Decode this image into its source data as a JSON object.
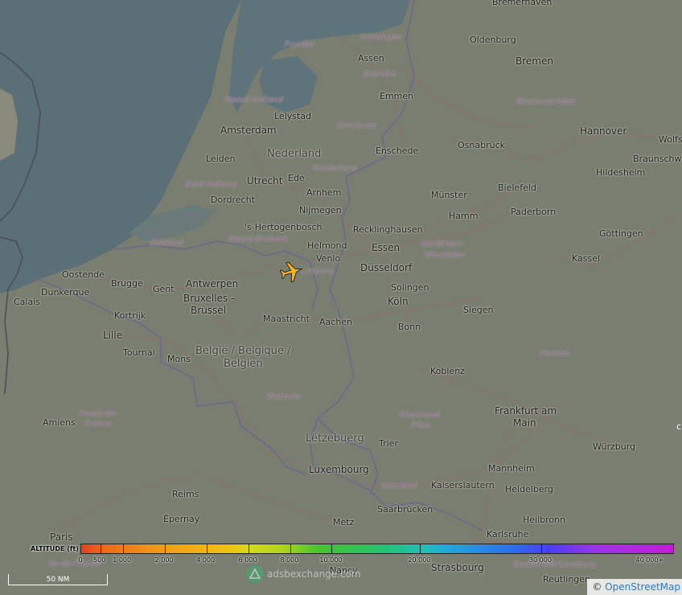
{
  "map": {
    "labels": [
      {
        "id": "bremerhaven",
        "text": "Bremerhaven",
        "cls": "city"
      },
      {
        "id": "oldenburg",
        "text": "Oldenburg",
        "cls": "city"
      },
      {
        "id": "bremen",
        "text": "Bremen",
        "cls": "big"
      },
      {
        "id": "niedersachsen",
        "text": "Niedersachsen",
        "cls": "region"
      },
      {
        "id": "hannover",
        "text": "Hannover",
        "cls": "big"
      },
      {
        "id": "wolfsburg",
        "text": "Wolfsb",
        "cls": "city"
      },
      {
        "id": "braunschweig",
        "text": "Braunschwei",
        "cls": "city"
      },
      {
        "id": "hildesheim",
        "text": "Hildesheim",
        "cls": "city"
      },
      {
        "id": "groningen",
        "text": "Groningen",
        "cls": "region"
      },
      {
        "id": "fryslan",
        "text": "Fryslân",
        "cls": "region"
      },
      {
        "id": "assen",
        "text": "Assen",
        "cls": "city"
      },
      {
        "id": "drenthe",
        "text": "Drenthe",
        "cls": "region"
      },
      {
        "id": "emmen",
        "text": "Emmen",
        "cls": "city"
      },
      {
        "id": "noord-holland",
        "text": "Noord-Holland",
        "cls": "region"
      },
      {
        "id": "lelystad",
        "text": "Lelystad",
        "cls": "city"
      },
      {
        "id": "overijssel",
        "text": "Overijssel",
        "cls": "region"
      },
      {
        "id": "amsterdam",
        "text": "Amsterdam",
        "cls": "big"
      },
      {
        "id": "nederland",
        "text": "Nederland",
        "cls": "country"
      },
      {
        "id": "enschede",
        "text": "Enschede",
        "cls": "city"
      },
      {
        "id": "osnabruck",
        "text": "Osnabrück",
        "cls": "city"
      },
      {
        "id": "leiden",
        "text": "Leiden",
        "cls": "city"
      },
      {
        "id": "gelderland",
        "text": "Gelderland",
        "cls": "region"
      },
      {
        "id": "utrecht",
        "text": "Utrecht",
        "cls": "big"
      },
      {
        "id": "ede",
        "text": "Ede",
        "cls": "city"
      },
      {
        "id": "zuid-holland",
        "text": "Zuid-Holland",
        "cls": "region"
      },
      {
        "id": "arnhem",
        "text": "Arnhem",
        "cls": "city"
      },
      {
        "id": "bielefeld",
        "text": "Bielefeld",
        "cls": "city"
      },
      {
        "id": "dordrecht",
        "text": "Dordrecht",
        "cls": "city"
      },
      {
        "id": "munster",
        "text": "Münster",
        "cls": "city"
      },
      {
        "id": "nijmegen",
        "text": "Nijmegen",
        "cls": "city"
      },
      {
        "id": "paderborn",
        "text": "Paderborn",
        "cls": "city"
      },
      {
        "id": "hamm",
        "text": "Hamm",
        "cls": "city"
      },
      {
        "id": "hertogenbosch",
        "text": "'s-Hertogenbosch",
        "cls": "city"
      },
      {
        "id": "recklinghausen",
        "text": "Recklinghausen",
        "cls": "city"
      },
      {
        "id": "zeeland",
        "text": "Zeeland",
        "cls": "region"
      },
      {
        "id": "noord-brabant",
        "text": "Noord-Brabant",
        "cls": "region"
      },
      {
        "id": "gottingen",
        "text": "Göttingen",
        "cls": "city"
      },
      {
        "id": "helmond",
        "text": "Helmond",
        "cls": "city"
      },
      {
        "id": "essen",
        "text": "Essen",
        "cls": "big"
      },
      {
        "id": "nrw1",
        "text": "Nordrhein-",
        "cls": "region"
      },
      {
        "id": "oostende",
        "text": "Oostende",
        "cls": "city"
      },
      {
        "id": "venlo",
        "text": "Venlo",
        "cls": "city"
      },
      {
        "id": "nrw2",
        "text": "Westfalen",
        "cls": "region"
      },
      {
        "id": "kassel",
        "text": "Kassel",
        "cls": "city"
      },
      {
        "id": "dusseldorf",
        "text": "Düsseldorf",
        "cls": "big"
      },
      {
        "id": "limburg",
        "text": "Limburg",
        "cls": "region"
      },
      {
        "id": "brugge",
        "text": "Brugge",
        "cls": "city"
      },
      {
        "id": "antwerpen",
        "text": "Antwerpen",
        "cls": "big"
      },
      {
        "id": "dunkerque",
        "text": "Dunkerque",
        "cls": "city"
      },
      {
        "id": "gent",
        "text": "Gent",
        "cls": "city"
      },
      {
        "id": "solingen",
        "text": "Solingen",
        "cls": "city"
      },
      {
        "id": "bruxelles",
        "text": "Bruxelles -",
        "cls": "big"
      },
      {
        "id": "calais",
        "text": "Calais",
        "cls": "city"
      },
      {
        "id": "brussel",
        "text": "Brussel",
        "cls": "big"
      },
      {
        "id": "koln",
        "text": "Köln",
        "cls": "big"
      },
      {
        "id": "siegen",
        "text": "Siegen",
        "cls": "city"
      },
      {
        "id": "kortrijk",
        "text": "Kortrijk",
        "cls": "city"
      },
      {
        "id": "maastricht",
        "text": "Maastricht",
        "cls": "city"
      },
      {
        "id": "aachen",
        "text": "Aachen",
        "cls": "city"
      },
      {
        "id": "bonn",
        "text": "Bonn",
        "cls": "city"
      },
      {
        "id": "lille",
        "text": "Lille",
        "cls": "big"
      },
      {
        "id": "belgie",
        "text": "België / Belgique /",
        "cls": "country"
      },
      {
        "id": "tournai",
        "text": "Tournai",
        "cls": "city"
      },
      {
        "id": "hessen",
        "text": "Hessen",
        "cls": "region"
      },
      {
        "id": "mons",
        "text": "Mons",
        "cls": "city"
      },
      {
        "id": "belgien",
        "text": "Belgien",
        "cls": "country"
      },
      {
        "id": "koblenz",
        "text": "Koblenz",
        "cls": "city"
      },
      {
        "id": "wallonie",
        "text": "Wallonie",
        "cls": "region"
      },
      {
        "id": "hdf1",
        "text": "Hauts-de-",
        "cls": "region"
      },
      {
        "id": "frankfurt1",
        "text": "Frankfurt am",
        "cls": "big"
      },
      {
        "id": "hdf2",
        "text": "France",
        "cls": "region"
      },
      {
        "id": "rp1",
        "text": "Rheinland-",
        "cls": "region"
      },
      {
        "id": "amiens",
        "text": "Amiens",
        "cls": "city"
      },
      {
        "id": "frankfurt2",
        "text": "Main",
        "cls": "big"
      },
      {
        "id": "rp2",
        "text": "Pfalz",
        "cls": "region"
      },
      {
        "id": "letzebuerg",
        "text": "Lëtzebuerg",
        "cls": "country"
      },
      {
        "id": "trier",
        "text": "Trier",
        "cls": "city"
      },
      {
        "id": "wurzburg",
        "text": "Würzburg",
        "cls": "city"
      },
      {
        "id": "luxembourg",
        "text": "Luxembourg",
        "cls": "big"
      },
      {
        "id": "mannheim",
        "text": "Mannheim",
        "cls": "city"
      },
      {
        "id": "kaiserslautern",
        "text": "Kaiserslautern",
        "cls": "city"
      },
      {
        "id": "saarland",
        "text": "Saarland",
        "cls": "region"
      },
      {
        "id": "heidelberg",
        "text": "Heidelberg",
        "cls": "city"
      },
      {
        "id": "reims",
        "text": "Reims",
        "cls": "city"
      },
      {
        "id": "saarbrucken",
        "text": "Saarbrücken",
        "cls": "city"
      },
      {
        "id": "epernay",
        "text": "Épernay",
        "cls": "city"
      },
      {
        "id": "heilbronn",
        "text": "Heilbronn",
        "cls": "city"
      },
      {
        "id": "metz",
        "text": "Metz",
        "cls": "city"
      },
      {
        "id": "karlsruhe",
        "text": "Karlsruhe",
        "cls": "city"
      },
      {
        "id": "paris",
        "text": "Paris",
        "cls": "big"
      },
      {
        "id": "nancy",
        "text": "Nancy",
        "cls": "city"
      },
      {
        "id": "strasbourg",
        "text": "Strasbourg",
        "cls": "big"
      },
      {
        "id": "bw",
        "text": "Baden-Württemberg",
        "cls": "region"
      },
      {
        "id": "idf",
        "text": "Île-de-France",
        "cls": "region"
      },
      {
        "id": "reutlingen",
        "text": "Reutlingen",
        "cls": "city"
      }
    ]
  },
  "legend": {
    "title": "ALTITUDE (ft)",
    "ticks": [
      "0",
      "500",
      "1 000",
      "2 000",
      "4 000",
      "6 000",
      "8 000",
      "10 000",
      "20 000",
      "30 000",
      "40 000+"
    ]
  },
  "scale": {
    "label": "50 NM"
  },
  "watermark": {
    "text": "adsbexchange.com"
  },
  "attribution": {
    "prefix": "©",
    "link": "OpenStreetMap"
  },
  "aircraft": {
    "icon": "airplane-icon",
    "color": "#f1b31c",
    "heading_deg": 75
  },
  "colors": {
    "sea": "#5b6f76",
    "land": "#7a7e70",
    "roads": "#9b6872",
    "borders": "#6c6c8a"
  }
}
